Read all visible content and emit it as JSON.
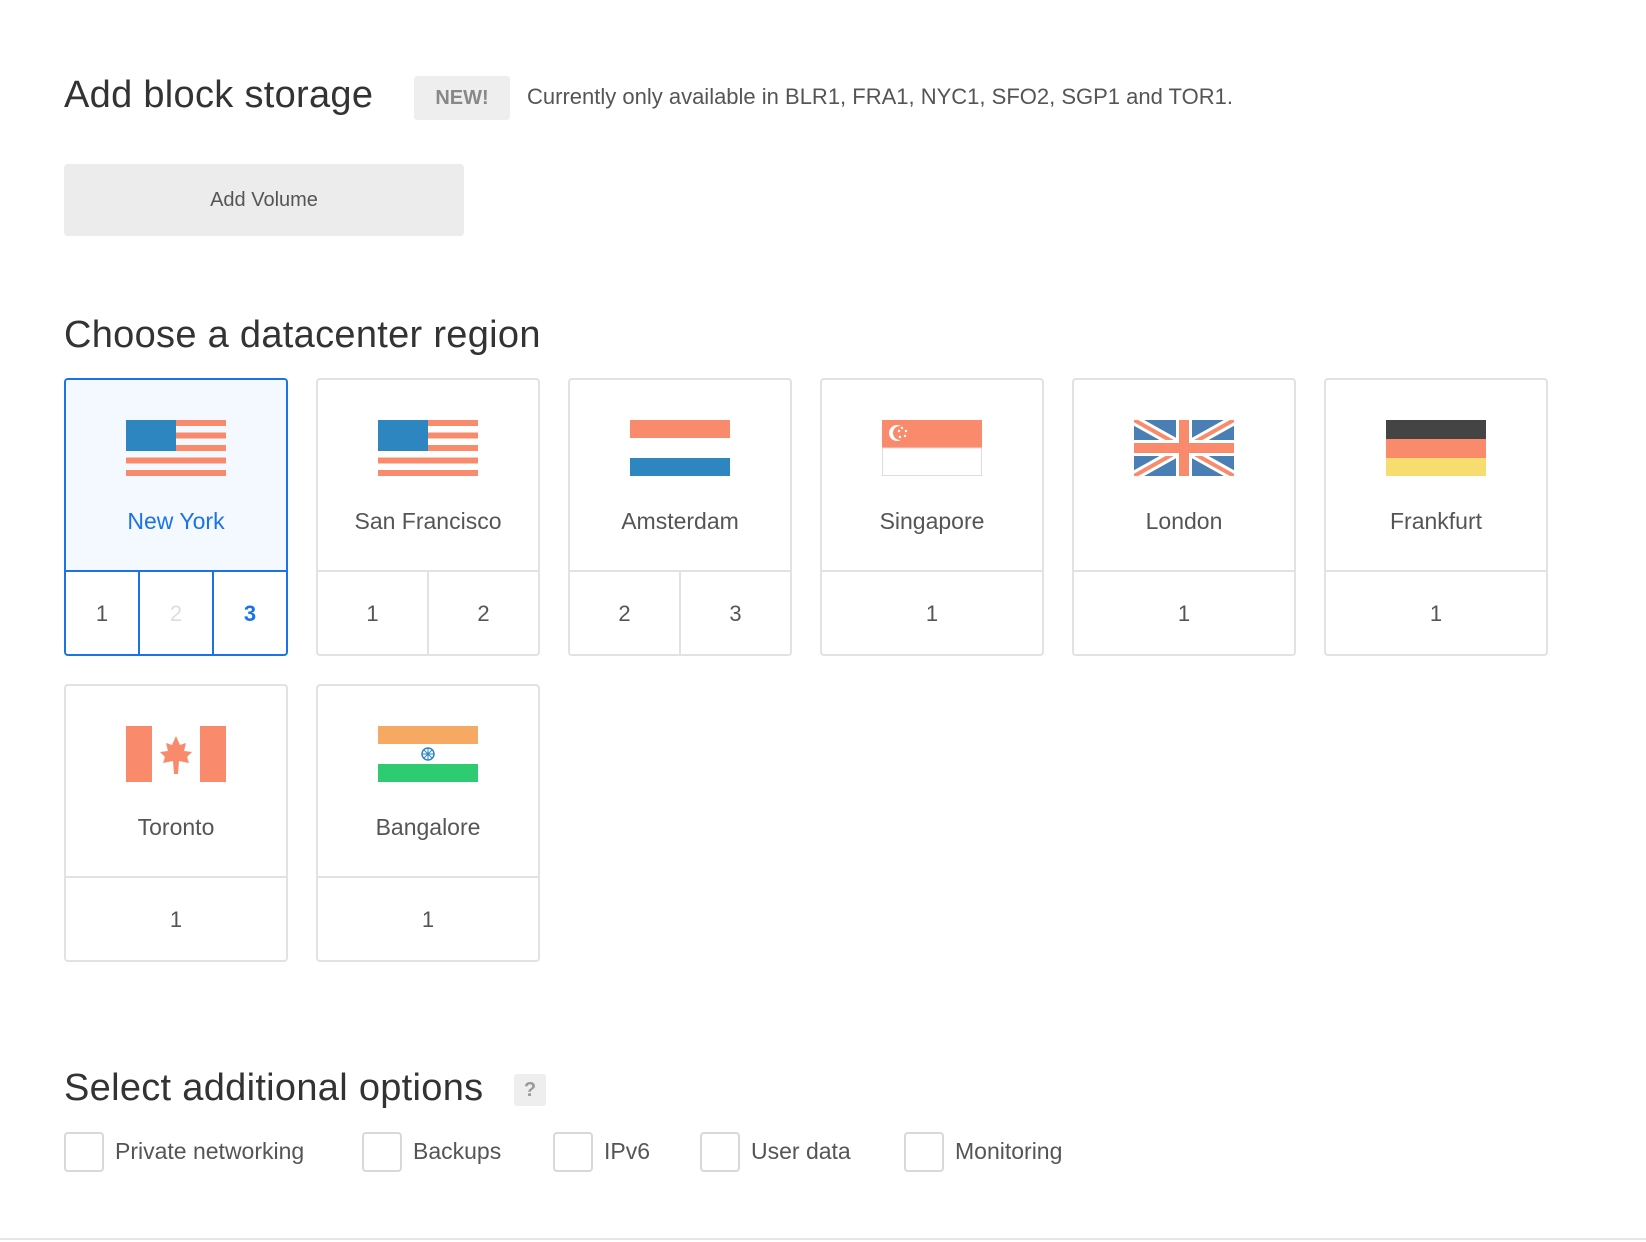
{
  "block_storage": {
    "title": "Add block storage",
    "badge": "NEW!",
    "note": "Currently only available in BLR1, FRA1, NYC1, SFO2, SGP1 and TOR1.",
    "button_label": "Add Volume"
  },
  "datacenter": {
    "title": "Choose a datacenter region",
    "selected_region": "New York",
    "selected_datacenter": "3",
    "regions": [
      {
        "name": "New York",
        "flag": "usa-flag-icon",
        "datacenters": [
          "1",
          "2",
          "3"
        ],
        "disabled": [
          "2"
        ]
      },
      {
        "name": "San Francisco",
        "flag": "usa-flag-icon",
        "datacenters": [
          "1",
          "2"
        ]
      },
      {
        "name": "Amsterdam",
        "flag": "netherlands-flag-icon",
        "datacenters": [
          "2",
          "3"
        ]
      },
      {
        "name": "Singapore",
        "flag": "singapore-flag-icon",
        "datacenters": [
          "1"
        ]
      },
      {
        "name": "London",
        "flag": "uk-flag-icon",
        "datacenters": [
          "1"
        ]
      },
      {
        "name": "Frankfurt",
        "flag": "germany-flag-icon",
        "datacenters": [
          "1"
        ]
      },
      {
        "name": "Toronto",
        "flag": "canada-flag-icon",
        "datacenters": [
          "1"
        ]
      },
      {
        "name": "Bangalore",
        "flag": "india-flag-icon",
        "datacenters": [
          "1"
        ]
      }
    ]
  },
  "options": {
    "title": "Select additional options",
    "help_label": "?",
    "items": [
      {
        "label": "Private networking",
        "checked": false
      },
      {
        "label": "Backups",
        "checked": false
      },
      {
        "label": "IPv6",
        "checked": false
      },
      {
        "label": "User data",
        "checked": false
      },
      {
        "label": "Monitoring",
        "checked": false
      }
    ]
  },
  "colors": {
    "accent": "#1a73e8",
    "flag_salmon": "#f98b6c",
    "flag_blue": "#2e86c1",
    "flag_dark": "#444444",
    "flag_yellow": "#f7dc6f",
    "flag_orange": "#f5a962",
    "flag_green": "#2ecc71"
  }
}
